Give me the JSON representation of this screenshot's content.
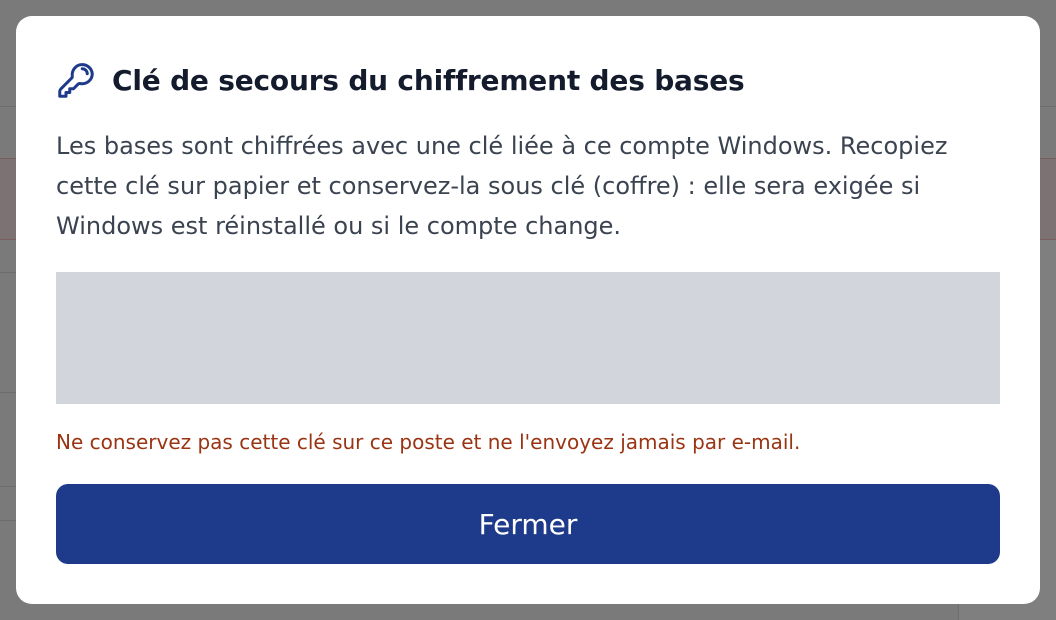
{
  "modal": {
    "title": "Clé de secours du chiffrement des bases",
    "icon": "key-icon",
    "description": "Les bases sont chiffrées avec une clé liée à ce compte Windows. Recopiez cette clé sur papier et conservez-la sous clé (coffre) : elle sera exigée si Windows est réinstallé ou si le compte change.",
    "recovery_key": "",
    "warning": "Ne conservez pas cette clé sur ce poste et ne l'envoyez jamais par e-mail.",
    "close_label": "Fermer"
  },
  "colors": {
    "accent": "#1e3a8a",
    "warning": "#9a3412",
    "key_box": "#d2d5dc",
    "overlay": "rgba(0,0,0,0.5)"
  }
}
